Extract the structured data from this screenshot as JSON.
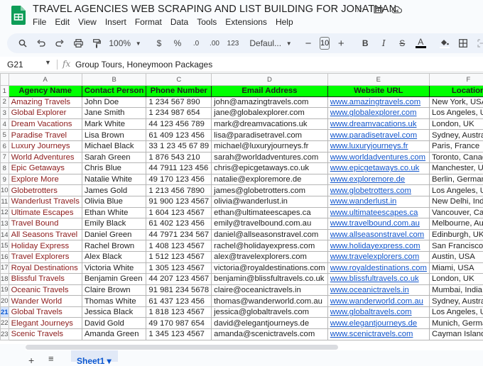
{
  "app": {
    "title": "TRAVEL AGENCIES WEB SCRAPING AND LIST BUILDING FOR JONATHAN.",
    "brand_color": "#0f9d58"
  },
  "menu": [
    "File",
    "Edit",
    "View",
    "Insert",
    "Format",
    "Data",
    "Tools",
    "Extensions",
    "Help"
  ],
  "toolbar": {
    "zoom": "100%",
    "currency": "$",
    "percent": "%",
    "decrease_decimal": ".0",
    "increase_decimal": ".00",
    "number_format": "123",
    "font": "Defaul...",
    "font_size": "10",
    "minus": "−",
    "plus": "+",
    "bold": "B",
    "italic": "I",
    "strike": "S",
    "text_color": "A"
  },
  "formula_bar": {
    "cell_ref": "G21",
    "fx": "fx",
    "value": "Group Tours, Honeymoon Packages"
  },
  "grid": {
    "column_letters": [
      "A",
      "B",
      "C",
      "D",
      "E",
      "F"
    ],
    "header_row_number": "1",
    "headers": [
      "Agency Name",
      "Contact Person",
      "Phone Number",
      "Email Address",
      "Website URL",
      "Location"
    ],
    "header_fill": "#00ff00",
    "selected_row": 21,
    "rows": [
      {
        "n": "2",
        "cells": [
          "Amazing Travels",
          "John Doe",
          "1 234 567 890",
          "john@amazingtravels.com",
          "www.amazingtravels.com",
          "New York, USA"
        ]
      },
      {
        "n": "3",
        "cells": [
          "Global Explorer",
          "Jane Smith",
          "1 234 987 654",
          "jane@globalexplorer.com",
          "www.globalexplorer.com",
          "Los Angeles, USA"
        ]
      },
      {
        "n": "4",
        "cells": [
          "Dream Vacations",
          "Mark White",
          "44 123 456 789",
          "mark@dreamvacations.uk",
          "www.dreamvacations.uk",
          "London, UK"
        ]
      },
      {
        "n": "5",
        "cells": [
          "Paradise Travel",
          "Lisa Brown",
          "61 409 123 456",
          "lisa@paradisetravel.com",
          "www.paradisetravel.com",
          "Sydney, Australia"
        ]
      },
      {
        "n": "6",
        "cells": [
          "Luxury Journeys",
          "Michael Black",
          "33 1 23 45 67 89",
          "michael@luxuryjourneys.fr",
          "www.luxuryjourneys.fr",
          "Paris, France"
        ]
      },
      {
        "n": "7",
        "cells": [
          "World Adventures",
          "Sarah Green",
          "1 876 543 210",
          "sarah@worldadventures.com",
          "www.worldadventures.com",
          "Toronto, Canada"
        ]
      },
      {
        "n": "8",
        "cells": [
          "Epic Getaways",
          "Chris Blue",
          "44 7911 123 456",
          "chris@epicgetaways.co.uk",
          "www.epicgetaways.co.uk",
          "Manchester, UK"
        ]
      },
      {
        "n": "9",
        "cells": [
          "Explore More",
          "Natalie White",
          "49 170 123 456",
          "natalie@exploremore.de",
          "www.exploremore.de",
          "Berlin, Germany"
        ]
      },
      {
        "n": "10",
        "cells": [
          "Globetrotters",
          "James Gold",
          "1 213 456 7890",
          "james@globetrotters.com",
          "www.globetrotters.com",
          "Los Angeles, USA"
        ]
      },
      {
        "n": "11",
        "cells": [
          "Wanderlust Travels",
          "Olivia Blue",
          "91 900 123 4567",
          "olivia@wanderlust.in",
          "www.wanderlust.in",
          "New Delhi, India"
        ]
      },
      {
        "n": "12",
        "cells": [
          "Ultimate Escapes",
          "Ethan White",
          "1 604 123 4567",
          "ethan@ultimateescapes.ca",
          "www.ultimateescapes.ca",
          "Vancouver, Canada"
        ]
      },
      {
        "n": "13",
        "cells": [
          "Travel Bound",
          "Emily Black",
          "61 402 123 456",
          "emily@travelbound.com.au",
          "www.travelbound.com.au",
          "Melbourne, Australia"
        ]
      },
      {
        "n": "14",
        "cells": [
          "All Seasons Travel",
          "Daniel Green",
          "44 7971 234 567",
          "daniel@allseasonstravel.com",
          "www.allseasonstravel.com",
          "Edinburgh, UK"
        ]
      },
      {
        "n": "15",
        "cells": [
          "Holiday Express",
          "Rachel Brown",
          "1 408 123 4567",
          "rachel@holidayexpress.com",
          "www.holidayexpress.com",
          "San Francisco, USA"
        ]
      },
      {
        "n": "16",
        "cells": [
          "Travel Explorers",
          "Alex Black",
          "1 512 123 4567",
          "alex@travelexplorers.com",
          "www.travelexplorers.com",
          "Austin, USA"
        ]
      },
      {
        "n": "17",
        "cells": [
          "Royal Destinations",
          "Victoria White",
          "1 305 123 4567",
          "victoria@royaldestinations.com",
          "www.royaldestinations.com",
          "Miami, USA"
        ]
      },
      {
        "n": "18",
        "cells": [
          "Blissful Travels",
          "Benjamin Green",
          "44 207 123 4567",
          "benjamin@blissfultravels.co.uk",
          "www.blissfultravels.co.uk",
          "London, UK"
        ]
      },
      {
        "n": "19",
        "cells": [
          "Oceanic Travels",
          "Claire Brown",
          "91 981 234 5678",
          "claire@oceanictravels.in",
          "www.oceanictravels.in",
          "Mumbai, India"
        ]
      },
      {
        "n": "20",
        "cells": [
          "Wander World",
          "Thomas White",
          "61 437 123 456",
          "thomas@wanderworld.com.au",
          "www.wanderworld.com.au",
          "Sydney, Australia"
        ]
      },
      {
        "n": "21",
        "cells": [
          "Global Travels",
          "Jessica Black",
          "1 818 123 4567",
          "jessica@globaltravels.com",
          "www.globaltravels.com",
          "Los Angeles, USA"
        ]
      },
      {
        "n": "22",
        "cells": [
          "Elegant Journeys",
          "David Gold",
          "49 170 987 654",
          "david@elegantjourneys.de",
          "www.elegantjourneys.de",
          "Munich, Germany"
        ]
      },
      {
        "n": "23",
        "cells": [
          "Scenic Travels",
          "Amanda Green",
          "1 345 123 4567",
          "amanda@scenictravels.com",
          "www.scenictravels.com",
          "Cayman Islands"
        ]
      }
    ]
  },
  "sheets": {
    "add": "+",
    "all": "≡",
    "active_tab": "Sheet1 ▾"
  }
}
